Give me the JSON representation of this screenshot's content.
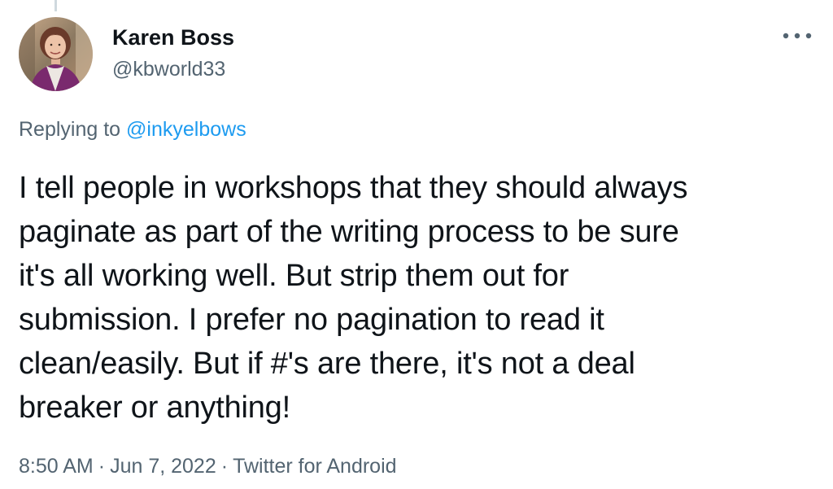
{
  "author": {
    "display_name": "Karen Boss",
    "handle": "@kbworld33",
    "avatar_icon": "profile-photo"
  },
  "more_icon": "more-horizontal-icon",
  "reply": {
    "prefix": "Replying to",
    "mention": "@inkyelbows"
  },
  "tweet": {
    "text": "I tell people in workshops that they should always\npaginate as part of the writing process to be sure\nit's all working well. But strip them out for\nsubmission. I prefer no pagination to read it\nclean/easily. But if #'s are there, it's not a deal\nbreaker or anything!"
  },
  "meta": {
    "time": "8:50 AM",
    "separator": "·",
    "date": "Jun 7, 2022",
    "source": "Twitter for Android"
  },
  "colors": {
    "text_primary": "#0f1419",
    "text_secondary": "#536471",
    "link": "#1d9bf0"
  }
}
